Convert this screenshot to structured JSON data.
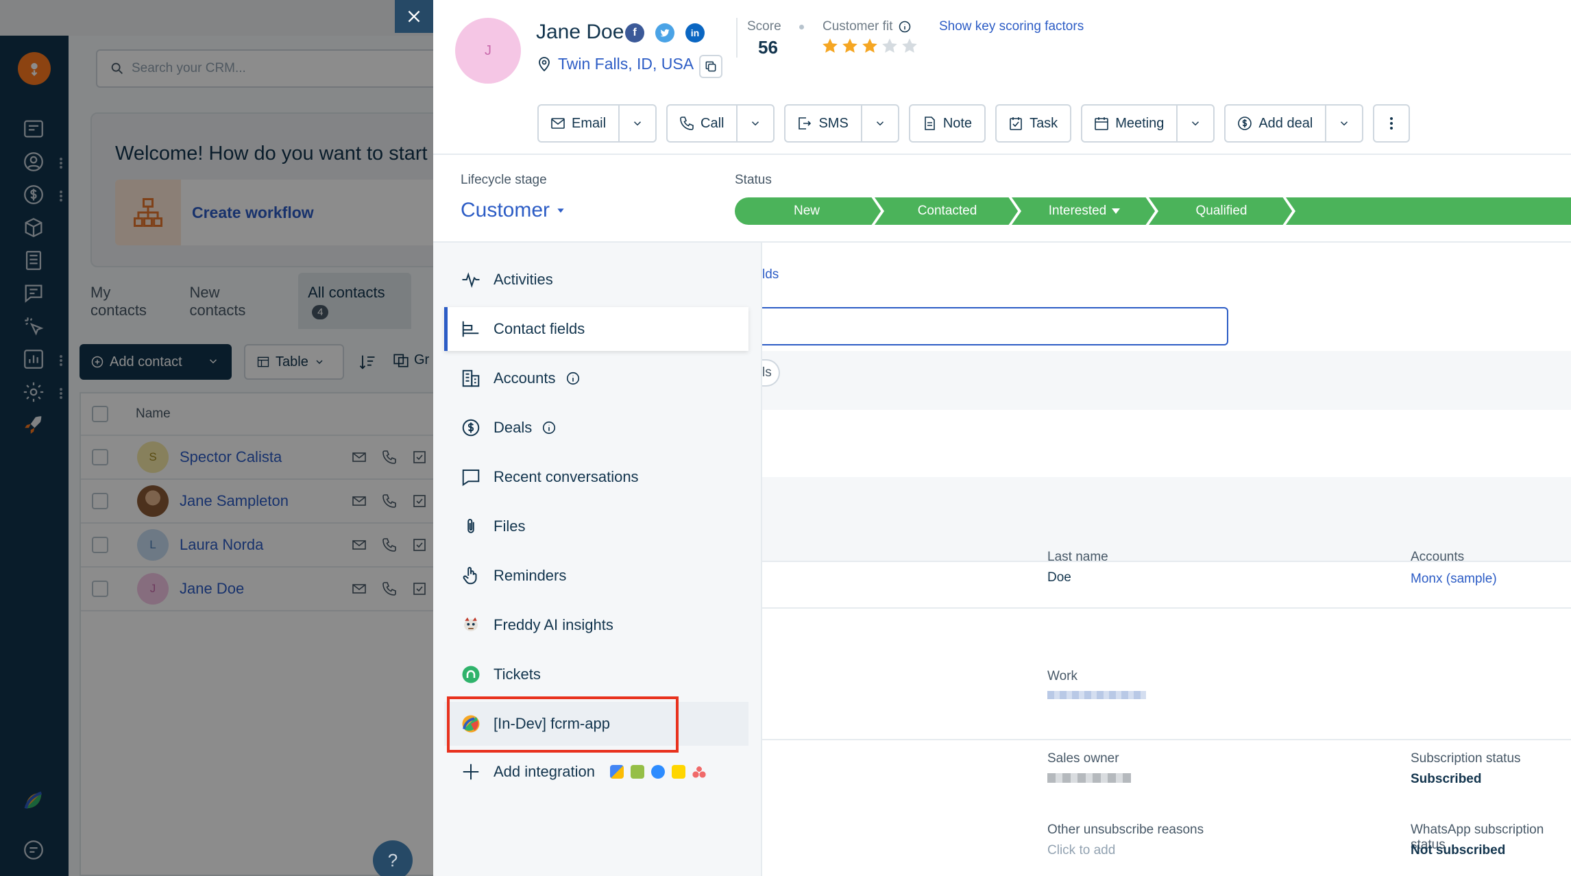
{
  "background": {
    "search_placeholder": "Search your CRM...",
    "welcome_title": "Welcome! How do you want to start",
    "create_workflow": "Create workflow",
    "tabs": [
      "My contacts",
      "New contacts",
      "All contacts"
    ],
    "all_contacts_badge": "4",
    "add_contact_label": "Add contact",
    "table_label": "Table",
    "group_label": "Gr",
    "list_header_name": "Name",
    "contacts": [
      {
        "initial": "S",
        "name": "Spector Calista"
      },
      {
        "initial": "",
        "name": "Jane Sampleton"
      },
      {
        "initial": "L",
        "name": "Laura Norda"
      },
      {
        "initial": "J",
        "name": "Jane Doe"
      }
    ],
    "help_label": "?"
  },
  "contact": {
    "initial": "J",
    "name": "Jane Doe",
    "location": "Twin Falls, ID, USA",
    "score_label": "Score",
    "score_value": "56",
    "fit_label": "Customer fit",
    "fit_stars": 3,
    "fit_stars_total": 5,
    "key_scoring_link": "Show key scoring factors"
  },
  "actions": {
    "email": "Email",
    "call": "Call",
    "sms": "SMS",
    "note": "Note",
    "task": "Task",
    "meeting": "Meeting",
    "add_deal": "Add deal"
  },
  "lifecycle": {
    "label": "Lifecycle stage",
    "value": "Customer"
  },
  "status": {
    "label": "Status",
    "stages": [
      "New",
      "Contacted",
      "Interested",
      "Qualified"
    ]
  },
  "nav": {
    "activities": "Activities",
    "contact_fields": "Contact fields",
    "accounts": "Accounts",
    "deals": "Deals",
    "recent_conversations": "Recent conversations",
    "files": "Files",
    "reminders": "Reminders",
    "freddy": "Freddy AI insights",
    "tickets": "Tickets",
    "dev_app": "[In-Dev] fcrm-app",
    "add_integration": "Add integration"
  },
  "fields": {
    "partial_link": "lds",
    "partial_chip": "ls",
    "last_name_label": "Last name",
    "last_name_value": "Doe",
    "accounts_label": "Accounts",
    "accounts_value": "Monx (sample)",
    "work_label": "Work",
    "sales_owner_label": "Sales owner",
    "subscription_label": "Subscription status",
    "subscription_value": "Subscribed",
    "other_unsub_label": "Other unsubscribe reasons",
    "other_unsub_value": "Click to add",
    "whatsapp_label": "WhatsApp subscription status",
    "whatsapp_value": "Not subscribed"
  },
  "colors": {
    "brand_blue": "#2c5cc5",
    "status_green": "#4bb35a",
    "highlight_red": "#e8321e",
    "star_orange": "#f5a623"
  }
}
